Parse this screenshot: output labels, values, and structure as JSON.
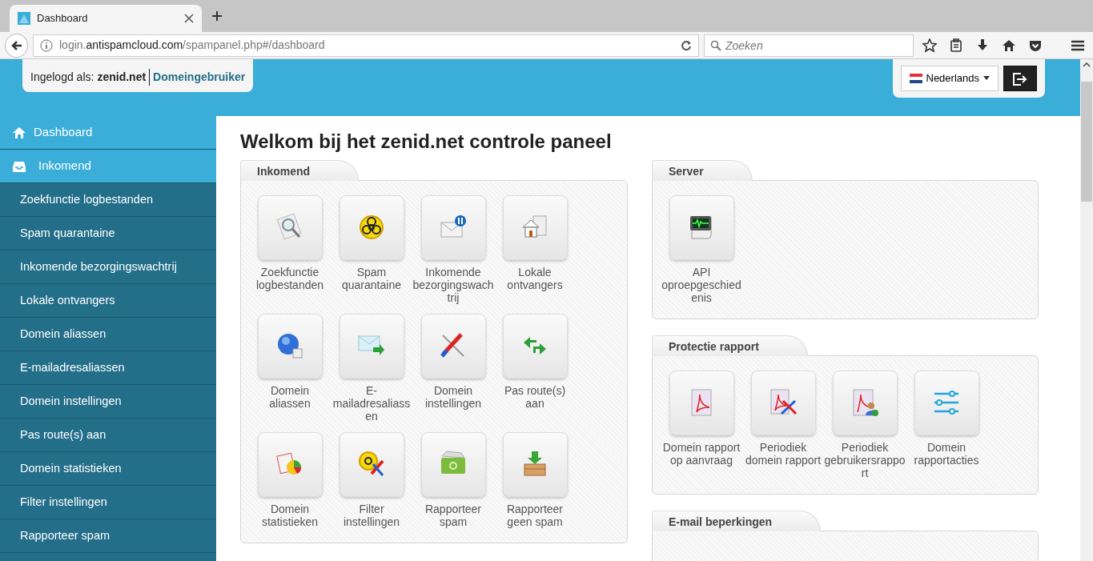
{
  "browser": {
    "tab": {
      "title": "Dashboard",
      "selected": true
    },
    "url": "login.**antispamcloud.com**/spampanel.php#/dashboard",
    "search": {
      "placeholder": "Zoeken"
    }
  },
  "header": {
    "login_label": "Ingelogd als:",
    "login_user": "zenid.net",
    "login_role": "Domeingebruiker",
    "language": "Nederlands"
  },
  "sidebar": {
    "items": [
      {
        "label": "Dashboard"
      },
      {
        "label": "Inkomend",
        "children": [
          {
            "label": "Zoekfunctie logbestanden"
          },
          {
            "label": "Spam quarantaine"
          },
          {
            "label": "Inkomende bezorgingswachtrij"
          },
          {
            "label": "Lokale ontvangers"
          },
          {
            "label": "Domein aliassen"
          },
          {
            "label": "E-mailadresaliassen"
          },
          {
            "label": "Domein instellingen"
          },
          {
            "label": "Pas route(s) aan"
          },
          {
            "label": "Domein statistieken"
          },
          {
            "label": "Filter instellingen"
          },
          {
            "label": "Rapporteer spam"
          }
        ]
      }
    ]
  },
  "title": "Welkom bij het zenid.net controle paneel",
  "columns": [
    [
      {
        "title": "Inkomend",
        "tiles": [
          {
            "label": "Zoekfunctie logbestanden"
          },
          {
            "label": "Spam quarantaine"
          },
          {
            "label": "Inkomende bezorgingswachtrij"
          },
          {
            "label": "Lokale ontvangers"
          },
          {
            "label": "Domein aliassen"
          },
          {
            "label": "E-mailadresaliassen"
          },
          {
            "label": "Domein instellingen"
          },
          {
            "label": "Pas route(s) aan"
          },
          {
            "label": "Domein statistieken"
          },
          {
            "label": "Filter instellingen"
          },
          {
            "label": "Rapporteer spam"
          },
          {
            "label": "Rapporteer geen spam"
          }
        ]
      }
    ],
    [
      {
        "title": "Server",
        "tiles": [
          {
            "label": "API oproepgeschiedenis"
          }
        ]
      },
      {
        "title": "Protectie rapport",
        "tiles": [
          {
            "label": "Domein rapport op aanvraag"
          },
          {
            "label": "Periodiek domein rapport"
          },
          {
            "label": "Periodiek gebruikersrapport"
          },
          {
            "label": "Domein rapportacties"
          }
        ]
      },
      {
        "title": "E-mail beperkingen"
      }
    ]
  ]
}
